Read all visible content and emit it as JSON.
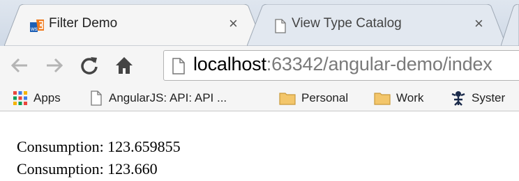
{
  "tabs": [
    {
      "title": "Filter Demo",
      "close": "×",
      "active": true
    },
    {
      "title": "View Type Catalog",
      "close": "×",
      "active": false
    }
  ],
  "toolbar": {
    "back_icon": "back-arrow-icon",
    "forward_icon": "forward-arrow-icon",
    "reload_icon": "reload-icon",
    "home_icon": "home-icon",
    "url_host": "localhost",
    "url_rest": ":63342/angular-demo/index"
  },
  "bookmarks": [
    {
      "label": "Apps",
      "icon": "apps-grid-icon"
    },
    {
      "label": "AngularJS: API: API ...",
      "icon": "page-icon"
    },
    {
      "label": "Personal",
      "icon": "folder-icon"
    },
    {
      "label": "Work",
      "icon": "folder-icon"
    },
    {
      "label": "Syster",
      "icon": "system-icon"
    }
  ],
  "content": {
    "lines": [
      "Consumption: 123.659855",
      "Consumption: 123.660"
    ]
  },
  "colors": {
    "tabstrip": "#dfe6ef",
    "toolbar": "#f5f5f5",
    "url_host": "#000000",
    "url_rest": "#7a7a7a"
  }
}
